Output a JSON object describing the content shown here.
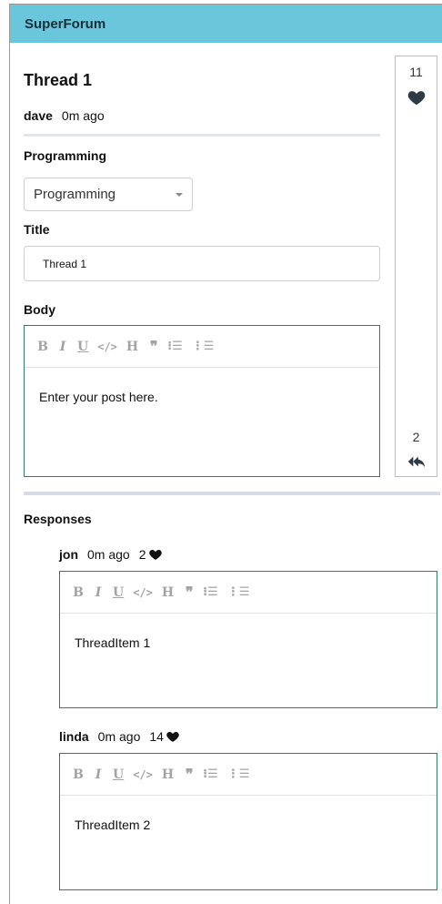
{
  "app": {
    "brand": "SuperForum"
  },
  "thread": {
    "title": "Thread 1",
    "user": "dave",
    "time": "0m ago",
    "category_label": "Programming",
    "category_selected": "Programming",
    "title_label": "Title",
    "title_value": "Thread 1",
    "body_label": "Body",
    "body_placeholder": "Enter your post here."
  },
  "sidebar": {
    "points": "11",
    "responses_count": "2"
  },
  "toolbar": {
    "bold": "B",
    "italic": "I",
    "underline": "U",
    "code": "</>",
    "heading": "H",
    "quote": "❞",
    "ordered_list": "⁝☰",
    "bullet_list": "⋮☰"
  },
  "responses": {
    "title": "Responses",
    "items": [
      {
        "user": "jon",
        "time": "0m ago",
        "likes": "2",
        "body": "ThreadItem 1"
      },
      {
        "user": "linda",
        "time": "0m ago",
        "likes": "14",
        "body": "ThreadItem 2"
      }
    ]
  },
  "icons": {
    "heart": "heart-icon",
    "reply": "reply-all-icon",
    "caret": "chevron-down-icon"
  },
  "colors": {
    "navbar": "#69c6db",
    "editor_border": "#2e7d6b",
    "divider": "#d8dce6"
  }
}
